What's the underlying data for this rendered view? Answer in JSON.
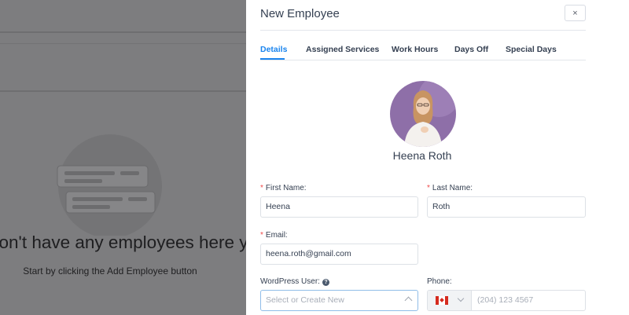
{
  "background": {
    "empty_title": "don't have any employees here yet.",
    "empty_subtitle": "Start by clicking the Add Employee button"
  },
  "drawer": {
    "title": "New Employee",
    "close_label": "×",
    "tabs": [
      {
        "label": "Details",
        "active": true
      },
      {
        "label": "Assigned Services",
        "active": false
      },
      {
        "label": "Work Hours",
        "active": false
      },
      {
        "label": "Days Off",
        "active": false
      },
      {
        "label": "Special Days",
        "active": false
      }
    ],
    "employee_name": "Heena Roth",
    "form": {
      "required_mark": "*",
      "first_name_label": "First Name:",
      "first_name_value": "Heena",
      "last_name_label": "Last Name:",
      "last_name_value": "Roth",
      "email_label": "Email:",
      "email_value": "heena.roth@gmail.com",
      "wp_user_label": "WordPress User:",
      "wp_user_help": "?",
      "wp_user_placeholder": "Select or Create New",
      "phone_label": "Phone:",
      "phone_placeholder": "(204) 123 4567",
      "phone_country": "canada-flag-icon"
    }
  },
  "colors": {
    "accent": "#1a84ee",
    "required": "#ef4b4b",
    "overlay": "#7b7b7d"
  }
}
